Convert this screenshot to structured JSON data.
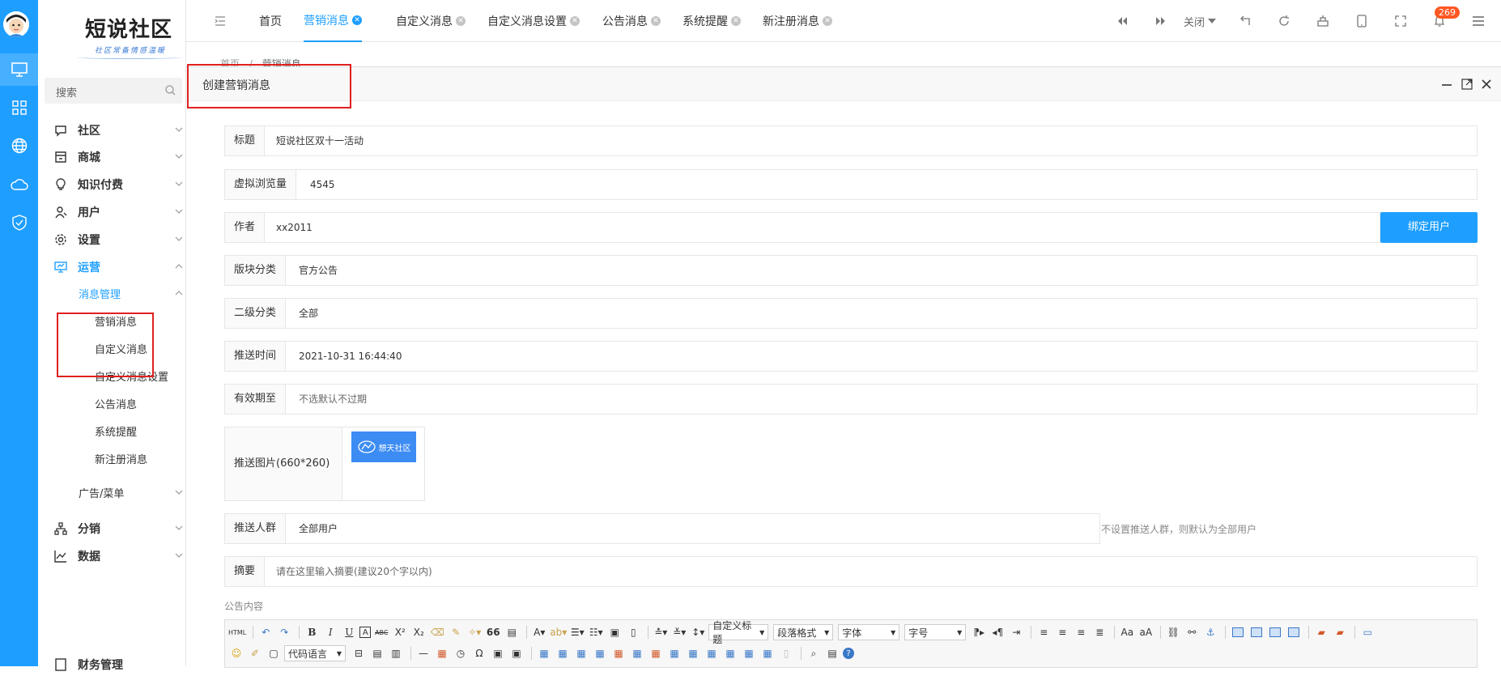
{
  "app": {
    "logo_title": "短说社区",
    "logo_subtitle": "社区常备情感温暖"
  },
  "sidebar": {
    "search_placeholder": "搜索",
    "menu": [
      {
        "label": "社区",
        "icon": "chat-icon",
        "open": false
      },
      {
        "label": "商城",
        "icon": "store-icon",
        "open": false
      },
      {
        "label": "知识付费",
        "icon": "lightbulb-icon",
        "open": false
      },
      {
        "label": "用户",
        "icon": "user-icon",
        "open": false
      },
      {
        "label": "设置",
        "icon": "gear-icon",
        "open": false
      },
      {
        "label": "运营",
        "icon": "monitor-icon",
        "open": true
      }
    ],
    "submenu_group": "消息管理",
    "submenu": [
      "营销消息",
      "自定义消息",
      "自定义消息设置",
      "公告消息",
      "系统提醒",
      "新注册消息"
    ],
    "ads_menu": "广告/菜单",
    "menu_bottom": [
      {
        "label": "分销",
        "icon": "org-chart-icon"
      },
      {
        "label": "数据",
        "icon": "line-chart-icon"
      },
      {
        "label": "财务管理",
        "icon": "finance-icon"
      }
    ]
  },
  "tabs": [
    {
      "label": "首页",
      "closable": false,
      "active": false
    },
    {
      "label": "营销消息",
      "closable": true,
      "active": true
    },
    {
      "label": "自定义消息",
      "closable": true,
      "active": false
    },
    {
      "label": "自定义消息设置",
      "closable": true,
      "active": false
    },
    {
      "label": "公告消息",
      "closable": true,
      "active": false
    },
    {
      "label": "系统提醒",
      "closable": true,
      "active": false
    },
    {
      "label": "新注册消息",
      "closable": true,
      "active": false
    }
  ],
  "topbar": {
    "close_label": "关闭",
    "notification_count": "269"
  },
  "breadcrumb": [
    "首页",
    "/",
    "营销消息"
  ],
  "modal": {
    "title": "创建营销消息"
  },
  "form": {
    "title_label": "标题",
    "title_value": "短说社区双十一活动",
    "views_label": "虚拟浏览量",
    "views_value": "4545",
    "author_label": "作者",
    "author_value": "xx2011",
    "bind_user_button": "绑定用户",
    "section_label": "版块分类",
    "section_value": "官方公告",
    "subsection_label": "二级分类",
    "subsection_value": "全部",
    "push_time_label": "推送时间",
    "push_time_value": "2021-10-31 16:44:40",
    "valid_until_label": "有效期至",
    "valid_until_placeholder": "不选默认不过期",
    "push_image_label": "推送图片(660*260)",
    "push_image_text": "想天社区",
    "audience_label": "推送人群",
    "audience_value": "全部用户",
    "audience_hint": "不设置推送人群，则默认为全部用户",
    "summary_label": "摘要",
    "summary_placeholder": "请在这里输入摘要(建议20个字以内)",
    "content_label": "公告内容"
  },
  "editor": {
    "html_label": "HTML",
    "custom_title": "自定义标题",
    "paragraph": "段落格式",
    "font": "字体",
    "font_size": "字号",
    "code_lang": "代码语言",
    "bold": "B",
    "italic": "I",
    "underline": "U",
    "strike": "ABC",
    "quote": "66",
    "omega": "Ω"
  },
  "colors": {
    "primary": "#1e9fff",
    "highlight": "#e02020",
    "badge": "#ff5722"
  }
}
